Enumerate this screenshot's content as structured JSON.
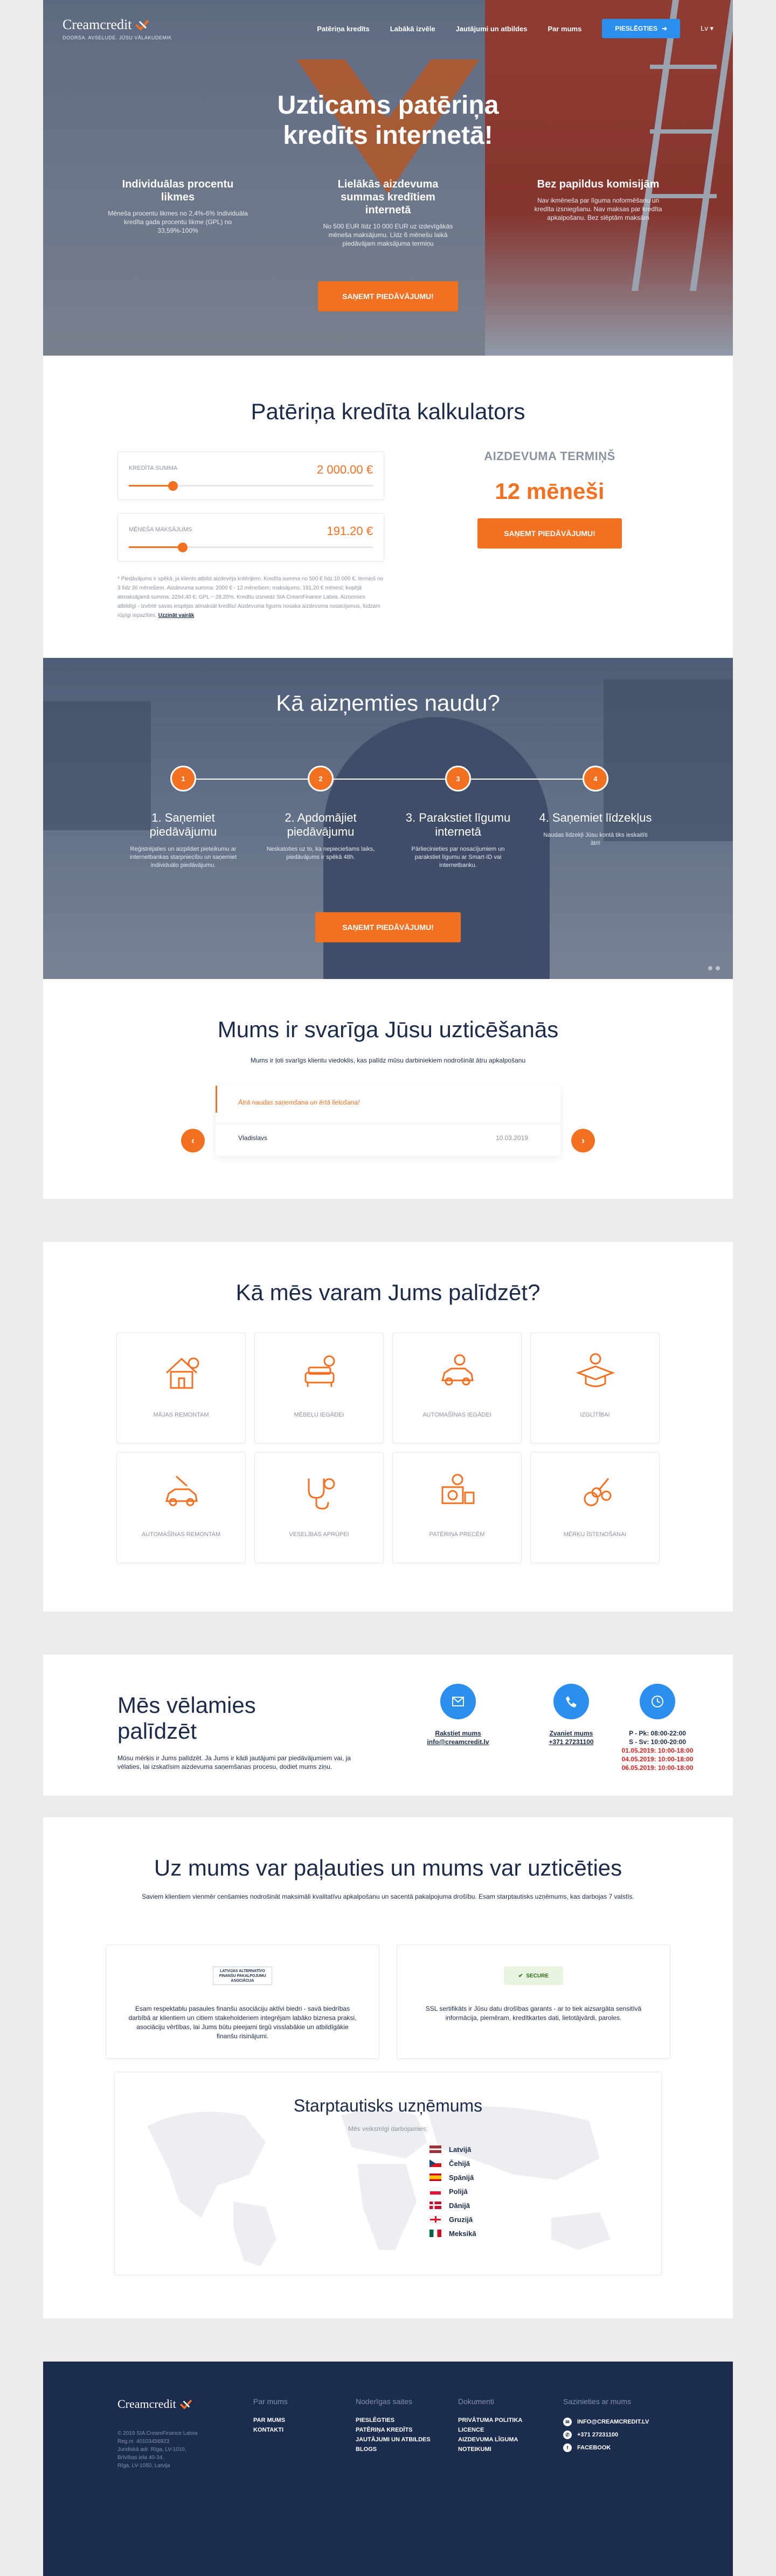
{
  "header": {
    "logo": "Creamcredit",
    "tagline": "DOORSA. AVSELUDE. JŪSU VĀLAKUDEMIK",
    "menu": [
      "Patēriņa kredīts",
      "Labākā izvēle",
      "Jautājumi un atbildes",
      "Par mums"
    ],
    "login_label": "PIESLĒGTIES",
    "lang": "Lv"
  },
  "hero": {
    "title": "Uzticams patēriņa kredīts internetā!",
    "features": [
      {
        "title": "Individuālas procentu likmes",
        "text": "Mēneša procentu likmes no 2,4%-6% Individuāla kredīta gada procentu likme (GPL) no 33,59%-100%"
      },
      {
        "title": "Lielākās aizdevuma summas kredītiem internetā",
        "text": "No 500 EUR līdz 10 000 EUR uz izdevīgākās mēneša maksājumu. Līdz 6 mēnešu laikā piedāvājam maksājuma termiņu"
      },
      {
        "title": "Bez papildus komisijām",
        "text": "Nav ikmēneša par līguma noformēšanu un kredīta izsniegšanu. Nav maksas par kredīta apkalpošanu. Bez slēptām maksām"
      }
    ],
    "cta": "SAŅEMT PIEDĀVĀJUMU!"
  },
  "calculator": {
    "title": "Patēriņa kredīta kalkulators",
    "amount_label": "KREDĪTA SUMMA",
    "amount_value": "2 000.00  €",
    "amount_fraction": 0.18,
    "payment_label": "MĒNEŠA MAKSĀJUMS",
    "payment_value": "191.20  €",
    "payment_fraction": 0.22,
    "term_label": "AIZDEVUMA TERMIŅŠ",
    "term_value": "12 mēneši",
    "cta": "SAŅEMT PIEDĀVĀJUMU!",
    "note": "* Piedāvājums ir spēkā, ja klients atbilst aizdevēja kritērijiem. Kredīta summa no 500 € līdz 10 000 €, termiņš no 3 līdz 36 mēnešiem. Aizdevuma summa: 2000 € - 12 mēnešiem; maksājums: 191,20 € mēnesī; kopējā atmaksājamā summa: 2294,40 €; GPL ~ 28,20%. Kredītu izsniedz SIA CreamFinance Latvia. Aizņemies atbildīgi - izvērtē savas iespējas atmaksāt kredītu! Aizdevuma līgums nosaka aizdevuma nosacījumus, lūdzam rūpīgi iepazīties. ",
    "note_link": "Uzzināt vairāk"
  },
  "how": {
    "title": "Kā aizņemties naudu?",
    "steps": [
      {
        "num": "1",
        "title": "1. Saņemiet piedāvājumu",
        "text": "Reģistrējaties un aizpildiet pieteikumu ar internetbankas starpniecību un saņemiet individuālo piedāvājumu."
      },
      {
        "num": "2",
        "title": "2. Apdomājiet piedāvājumu",
        "text": "Neskatoties uz to, ka nepieciešams laiks, piedāvājums ir spēkā 48h."
      },
      {
        "num": "3",
        "title": "3. Parakstiet līgumu internetā",
        "text": "Pārliecinieties par nosacījumiem un parakstiet līgumu ar Smart-ID vai internetbanku."
      },
      {
        "num": "4",
        "title": "4. Saņemiet līdzekļus",
        "text": "Naudas līdzekļi Jūsu kontā tiks ieskaitīti ātri!"
      }
    ],
    "cta": "SAŅEMT PIEDĀVĀJUMU!"
  },
  "trust": {
    "title": "Mums ir svarīga Jūsu uzticēšanās",
    "subtitle": "Mums ir ļoti svarīgs klientu viedoklis, kas palīdz mūsu darbiniekiem nodrošināt ātru apkalpošanu",
    "review_text": "Ātrā naudas saņemšana un ērtā lietošana!",
    "review_name": "Vladislavs",
    "review_date": "10.03.2019",
    "prev": "‹",
    "next": "›"
  },
  "help": {
    "title": "Kā mēs varam Jums palīdzēt?",
    "items": [
      {
        "icon": "house-icon",
        "label": "MĀJAS REMONTAM"
      },
      {
        "icon": "sofa-icon",
        "label": "MĒBEĻU IEGĀDEI"
      },
      {
        "icon": "car-icon",
        "label": "AUTOMAŠĪNAS IEGĀDEI"
      },
      {
        "icon": "graduation-cap-icon",
        "label": "IZGLĪTĪBAI"
      },
      {
        "icon": "car-repair-icon",
        "label": "AUTOMAŠĪNAS REMONTAM"
      },
      {
        "icon": "stethoscope-icon",
        "label": "VESELĪBAS APRŪPEI"
      },
      {
        "icon": "appliances-icon",
        "label": "PATĒRIŅA PRECĒM"
      },
      {
        "icon": "guitar-icon",
        "label": "MĒRĶU ĪSTENOŠANAI"
      }
    ]
  },
  "contact": {
    "title": "Mēs vēlamies palīdzēt",
    "text": "Mūsu mērķis ir Jums palīdzēt. Ja Jums ir kādi jautājumi par piedāvājumiem vai, ja vēlaties, lai izskatīsim aizdevuma saņemšanas procesu, dodiet mums ziņu.",
    "write_label": "Rakstiet mums",
    "email": "info@creamcredit.lv",
    "call_label": "Zvaniet mums",
    "phone": "+371 27231100",
    "hours": [
      "P - Pk: 08:00-22:00",
      "S - Sv: 10:00-20:00"
    ],
    "special_hours": [
      "01.05.2019: 10:00-18:00",
      "04.05.2019: 10:00-18:00",
      "06.05.2019: 10:00-18:00"
    ]
  },
  "rely": {
    "title": "Uz mums var paļauties un mums var uzticēties",
    "subtitle": "Saviem klientiem vienmēr cenšamies nodrošināt maksimāli kvalitatīvu apkalpošanu un sacentā pakalpojuma drošību. Esam starptautisks uzņēmums, kas darbojas 7 valstīs.",
    "card1_badge": "LATVIJAS ALTERNATĪVO FINANŠU PAKALPOJUMU ASOCIĀCIJA",
    "card1_text": "Esam respektablu pasaules finanšu asociāciju aktīvi biedri - savā biedrības darbībā ar klientiem un citiem stakeholderiem integrējam labāko biznesa praksi, asociāciju vērtības, lai Jums būtu pieejami tirgū visslabākie un atbildīgākie finanšu risinājumi.",
    "card2_badge": "SECURE",
    "card2_text": "SSL sertifikāts ir Jūsu datu drošības garants - ar to tiek aizsargāta sensitīvā informācija, piemēram, kredītkartes dati, lietotājvārdi, paroles.",
    "intl_title": "Starptautisks uzņēmums",
    "intl_sub": "Mēs veiksmīgi darbojamies:",
    "countries": [
      "Latvijā",
      "Čehijā",
      "Spānijā",
      "Polijā",
      "Dānijā",
      "Gruzijā",
      "Meksikā"
    ]
  },
  "footer": {
    "logo": "Creamcredit",
    "address": [
      "© 2019 SIA CreamFinance Latvia",
      "Reg.nr. 40103456923",
      "Juridiskā adr. Rīga, LV-1010,",
      "Brīvības iela 40-34,",
      "Rīga, LV-1050, Latvija"
    ],
    "col1_head": "Par mums",
    "col1": [
      "PAR MUMS",
      "KONTAKTI"
    ],
    "col2_head": "Noderīgas saites",
    "col2": [
      "PIESLĒGTIES",
      "PATĒRIŅA KREDĪTS",
      "JAUTĀJUMI UN ATBILDES",
      "BLOGS"
    ],
    "col3_head": "Dokumenti",
    "col3": [
      "PRIVĀTUMA POLITIKA",
      "LICENCE",
      "AIZDEVUMA LĪGUMA NOTEIKUMI"
    ],
    "col4_head": "Sazinieties ar mums",
    "col4": [
      "INFO@CREAMCREDIT.LV",
      "+371 27231100",
      "FACEBOOK"
    ]
  },
  "colors": {
    "accent": "#f37021",
    "navy": "#1c2c4e",
    "blue": "#2b8ff0"
  }
}
